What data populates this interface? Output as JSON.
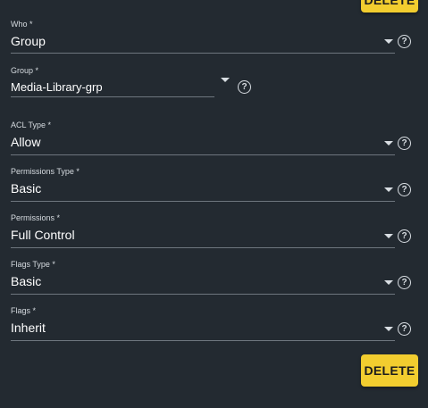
{
  "buttons": {
    "delete_top": "DELETE",
    "delete_bottom": "DELETE"
  },
  "fields": {
    "who": {
      "label": "Who *",
      "value": "Group"
    },
    "group": {
      "label": "Group *",
      "value": "Media-Library-grp"
    },
    "acl_type": {
      "label": "ACL Type *",
      "value": "Allow"
    },
    "permissions_type": {
      "label": "Permissions Type *",
      "value": "Basic"
    },
    "permissions": {
      "label": "Permissions *",
      "value": "Full Control"
    },
    "flags_type": {
      "label": "Flags Type *",
      "value": "Basic"
    },
    "flags": {
      "label": "Flags *",
      "value": "Inherit"
    }
  },
  "icons": {
    "dropdown": "chevron-down-icon",
    "help": "help-circle-icon",
    "help_glyph": "?"
  },
  "colors": {
    "background": "#232a31",
    "accent_button": "#f2cd2f",
    "underline": "#6e767e"
  }
}
